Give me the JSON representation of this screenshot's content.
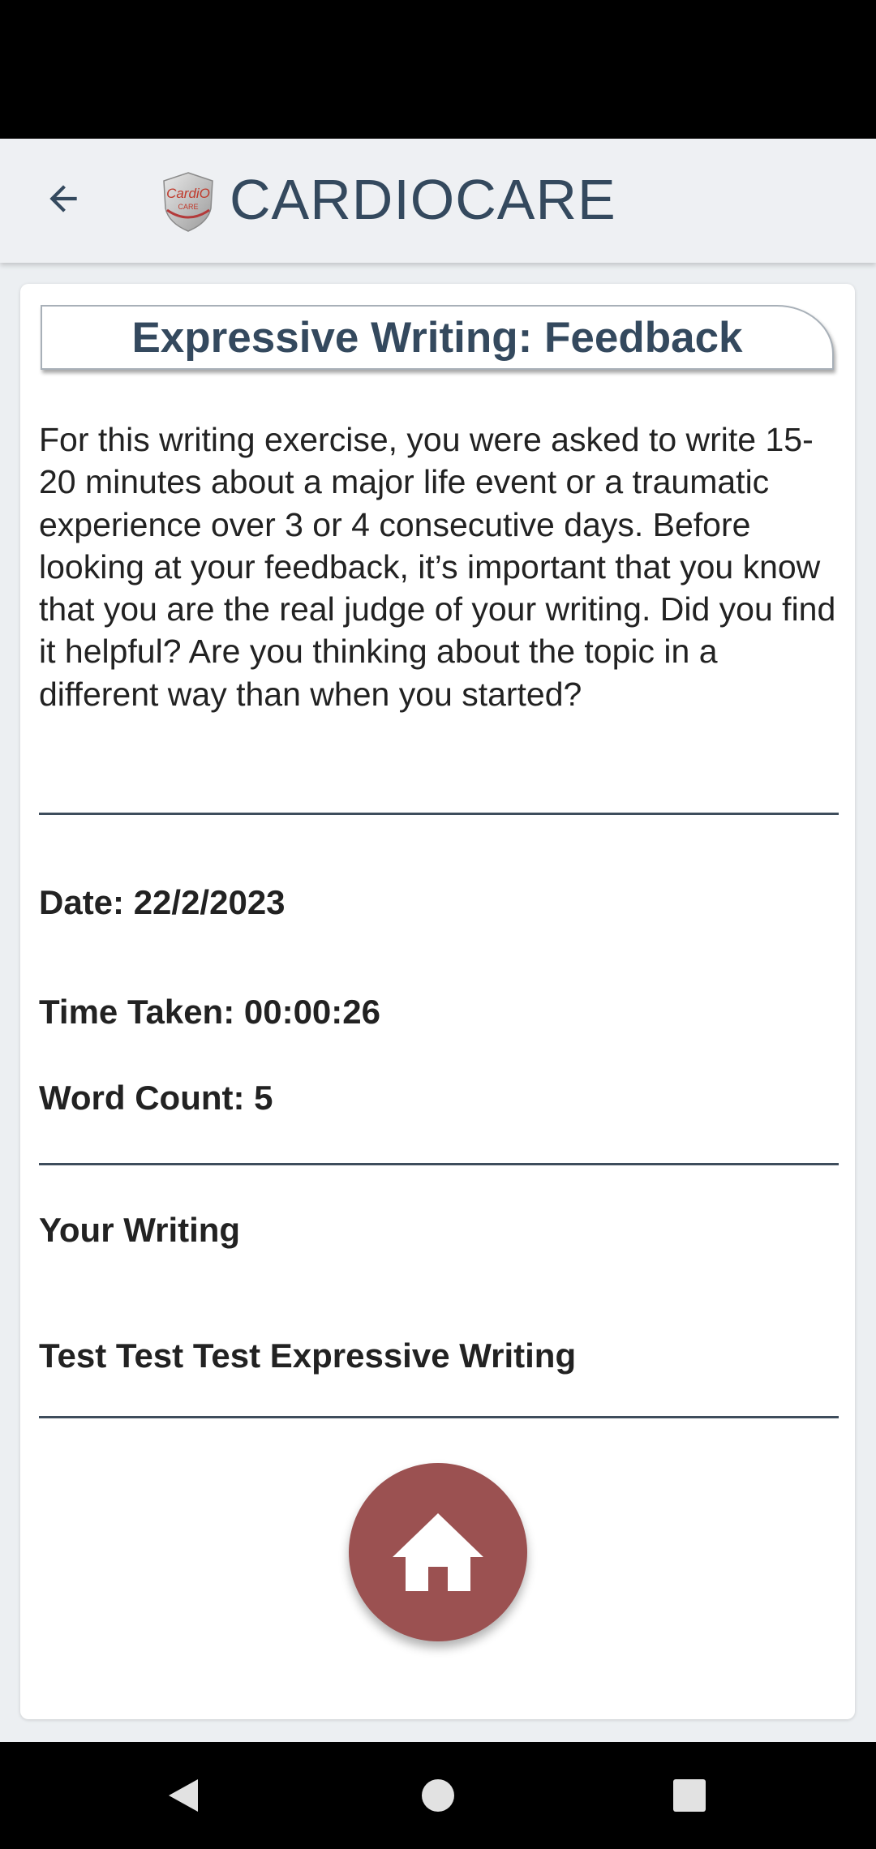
{
  "app_bar": {
    "title": "CARDIOCARE",
    "back_icon": "arrow-left-icon",
    "logo": {
      "line1": "CardiO",
      "line2": "CARE"
    }
  },
  "feedback": {
    "heading": "Expressive Writing: Feedback",
    "intro": "For this writing exercise, you were asked to write 15-20 minutes about a major life event or a traumatic experience over 3 or 4 consecutive days. Before looking at your feedback, it’s important that you know that you are the real judge of your writing. Did you find it helpful? Are you thinking about the topic in a different way than when you started?",
    "date": "Date: 22/2/2023",
    "time_taken": "Time Taken: 00:00:26",
    "word_count": "Word Count: 5",
    "your_writing_label": "Your Writing",
    "writing_text": "Test Test Test Expressive Writing"
  },
  "home_button": {
    "icon": "home-icon",
    "color": "#9b5151"
  },
  "system_nav": {
    "back": "back-triangle-icon",
    "home": "home-circle-icon",
    "recents": "recents-square-icon"
  },
  "colors": {
    "title": "#34495e",
    "accent": "#9b5151",
    "divider": "#3e4d5c"
  }
}
